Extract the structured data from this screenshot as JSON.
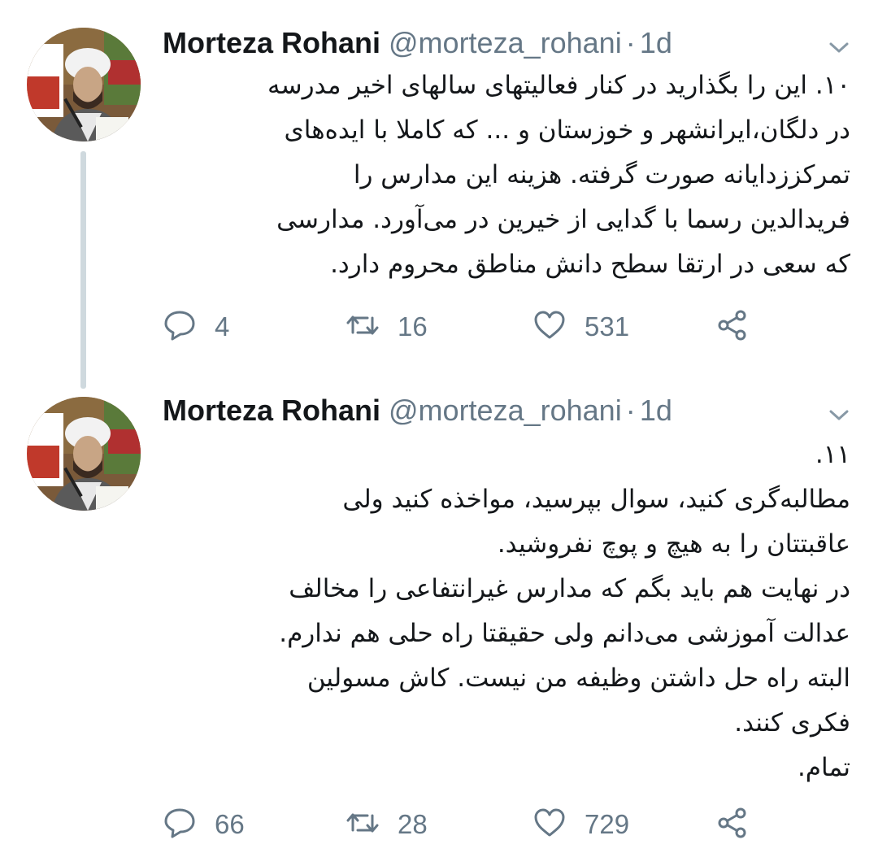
{
  "tweets": [
    {
      "name": "Morteza Rohani",
      "handle": "@morteza_rohani",
      "dot": "·",
      "time": "1d",
      "lines": [
        "۱۰. این را بگذارید در کنار فعالیتهای سالهای اخیر مدرسه",
        "در دلگان،ایرانشهر و خوزستان و ... که کاملا با ایده‌های",
        "تمرکززدایانه صورت گرفته. هزینه این مدارس را",
        "فریدالدین رسما با گدایی از خیرین در می‌آورد. مدارسی",
        "که سعی در ارتقا سطح دانش مناطق محروم دارد."
      ],
      "replies": "4",
      "retweets": "16",
      "likes": "531"
    },
    {
      "name": "Morteza Rohani",
      "handle": "@morteza_rohani",
      "dot": "·",
      "time": "1d",
      "lines": [
        "۱۱.",
        "مطالبه‌گری کنید، سوال بپرسید، مواخذه کنید ولی",
        "عاقبتتان را به هیچ و پوچ نفروشید.",
        "در نهایت هم باید بگم که مدارس غیرانتفاعی را مخالف",
        "عدالت آموزشی می‌دانم ولی حقیقتا راه حلی هم ندارم.",
        "البته راه حل داشتن وظیفه من نیست. کاش مسولین",
        "فکری کنند.",
        "تمام."
      ],
      "replies": "66",
      "retweets": "28",
      "likes": "729"
    }
  ],
  "icons": {
    "reply": "speech-bubble-icon",
    "retweet": "retweet-arrows-icon",
    "like": "heart-icon",
    "share": "share-nodes-icon",
    "caret": "chevron-down-icon"
  },
  "colors": {
    "text": "#14171a",
    "muted": "#657786",
    "thread_line": "#cfd9de"
  }
}
